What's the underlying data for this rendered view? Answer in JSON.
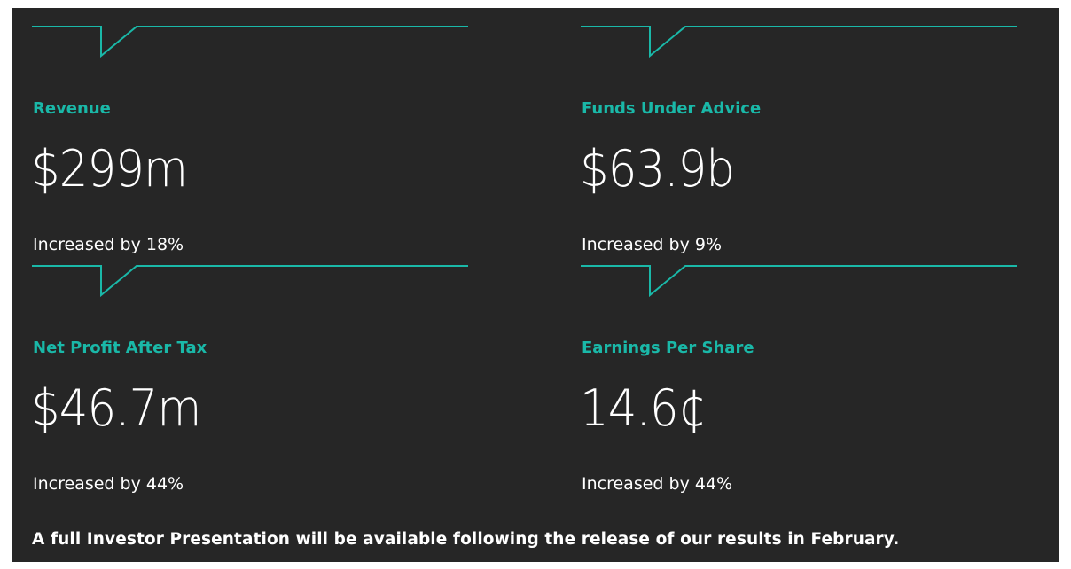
{
  "metrics": [
    {
      "label": "Revenue",
      "value": "$299m",
      "change": "Increased by 18%"
    },
    {
      "label": "Funds Under Advice",
      "value": "$63.9b",
      "change": "Increased by 9%"
    },
    {
      "label": "Net Profit After Tax",
      "value": "$46.7m",
      "change": "Increased by 44%"
    },
    {
      "label": "Earnings Per Share",
      "value": "14.6¢",
      "change": "Increased by 44%"
    }
  ],
  "footnote": "A full Investor Presentation will be available following the release of our results in February.",
  "colors": {
    "background": "#262626",
    "accent": "#1ab8a8",
    "text": "#ffffff"
  }
}
